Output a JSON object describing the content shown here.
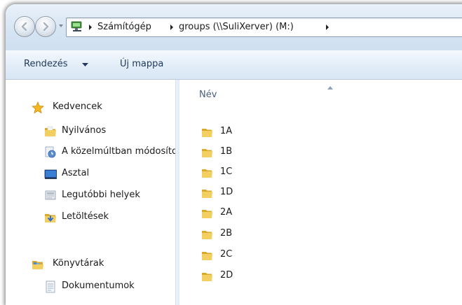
{
  "address": {
    "crumbs": [
      "Számítógép",
      "groups (\\\\SuliXerver) (M:)"
    ]
  },
  "toolbar": {
    "organize_label": "Rendezés",
    "new_folder_label": "Új mappa"
  },
  "nav": {
    "favorites": {
      "label": "Kedvencek",
      "items": [
        {
          "label": "Nyilvános",
          "icon": "folder-icon"
        },
        {
          "label": "A közelmúltban módosított",
          "icon": "recent-changes-icon"
        },
        {
          "label": "Asztal",
          "icon": "desktop-icon"
        },
        {
          "label": "Legutóbbi helyek",
          "icon": "recent-places-icon"
        },
        {
          "label": "Letöltések",
          "icon": "downloads-icon"
        }
      ]
    },
    "libraries": {
      "label": "Könyvtárak",
      "items": [
        {
          "label": "Dokumentumok",
          "icon": "documents-icon"
        }
      ]
    }
  },
  "content": {
    "column_name": "Név",
    "files": [
      "1A",
      "1B",
      "1C",
      "1D",
      "2A",
      "2B",
      "2C",
      "2D"
    ]
  },
  "colors": {
    "folder": "#e8c24e",
    "toolbar_text": "#1e395b",
    "header_text": "#4c607a"
  }
}
